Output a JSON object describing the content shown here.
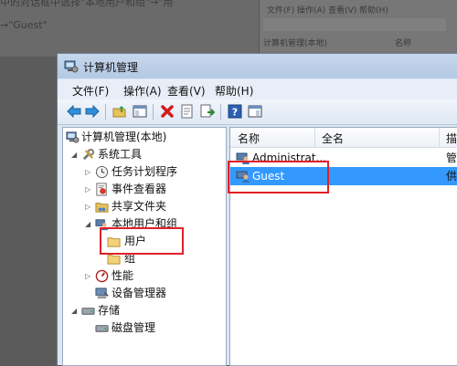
{
  "article": {
    "line1": "中的对话框中选择\"本地用户和组\"→\"用",
    "line2": "→\"Guest\""
  },
  "background_window": {
    "menu": "文件(F) 操作(A) 查看(V) 帮助(H)",
    "tree_item": "计算机管理(本地)",
    "list_header": "名称"
  },
  "window": {
    "title": "计算机管理"
  },
  "menubar": {
    "file": "文件(F)",
    "action": "操作(A)",
    "view": "查看(V)",
    "help": "帮助(H)"
  },
  "tree": {
    "root": "计算机管理(本地)",
    "system_tools": "系统工具",
    "task_scheduler": "任务计划程序",
    "event_viewer": "事件查看器",
    "shared_folders": "共享文件夹",
    "local_users_groups": "本地用户和组",
    "users": "用户",
    "groups": "组",
    "performance": "性能",
    "device_manager": "设备管理器",
    "storage": "存储",
    "disk_management": "磁盘管理"
  },
  "list": {
    "columns": [
      "名称",
      "全名",
      "描"
    ],
    "rows": [
      {
        "name": "Administrat...",
        "tail": "管",
        "selected": false
      },
      {
        "name": "Guest",
        "tail": "供",
        "selected": true
      }
    ]
  },
  "colors": {
    "selection": "#3399ff",
    "highlight": "#e0202a"
  }
}
